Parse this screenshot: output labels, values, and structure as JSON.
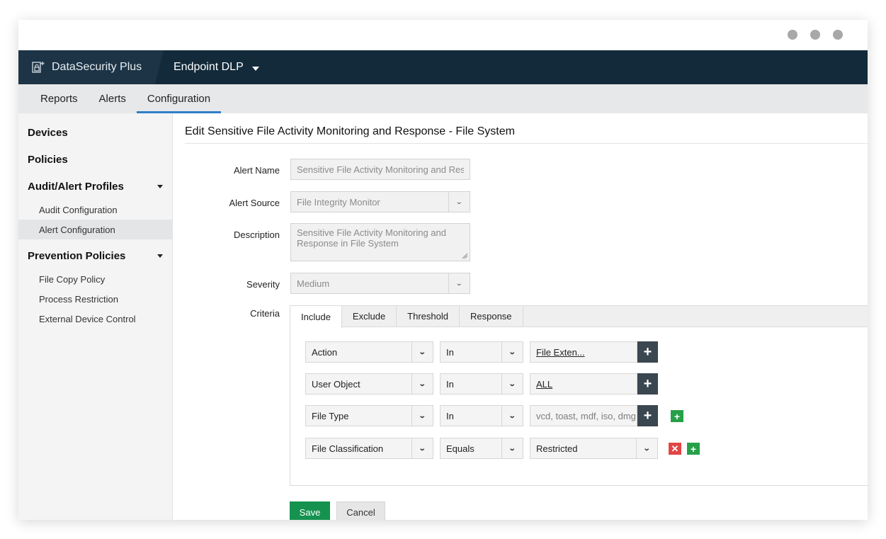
{
  "app": {
    "brand": "DataSecurity Plus",
    "module": "Endpoint DLP"
  },
  "nav": {
    "tabs": [
      "Reports",
      "Alerts",
      "Configuration"
    ],
    "active": "Configuration"
  },
  "sidebar": {
    "devices": "Devices",
    "policies": "Policies",
    "audit_profiles": "Audit/Alert Profiles",
    "audit_configuration": "Audit Configuration",
    "alert_configuration": "Alert Configuration",
    "prevention_policies": "Prevention Policies",
    "file_copy_policy": "File Copy Policy",
    "process_restriction": "Process Restriction",
    "external_device_control": "External Device Control"
  },
  "form": {
    "title": "Edit Sensitive File Activity Monitoring and Response - File System",
    "alert_name_label": "Alert Name",
    "alert_name_value": "Sensitive File Activity Monitoring and Resp",
    "alert_source_label": "Alert Source",
    "alert_source_value": "File Integrity Monitor",
    "description_label": "Description",
    "description_value": "Sensitive File Activity Monitoring and Response in File System",
    "severity_label": "Severity",
    "severity_value": "Medium",
    "criteria_label": "Criteria"
  },
  "criteria": {
    "tabs": [
      "Include",
      "Exclude",
      "Threshold",
      "Response"
    ],
    "active_tab": "Include",
    "rows": [
      {
        "field": "Action",
        "operator": "In",
        "value": "File Exten..."
      },
      {
        "field": "User Object",
        "operator": "In",
        "value": "ALL"
      },
      {
        "field": "File Type",
        "operator": "In",
        "value": "vcd, toast, mdf, iso, dmg"
      },
      {
        "field": "File Classification",
        "operator": "Equals",
        "value": "Restricted"
      }
    ]
  },
  "actions": {
    "save": "Save",
    "cancel": "Cancel"
  },
  "colors": {
    "topbar": "#132a3a",
    "accent": "#2f7fc6",
    "save": "#15924f",
    "add": "#27a04a",
    "remove": "#e24545"
  }
}
